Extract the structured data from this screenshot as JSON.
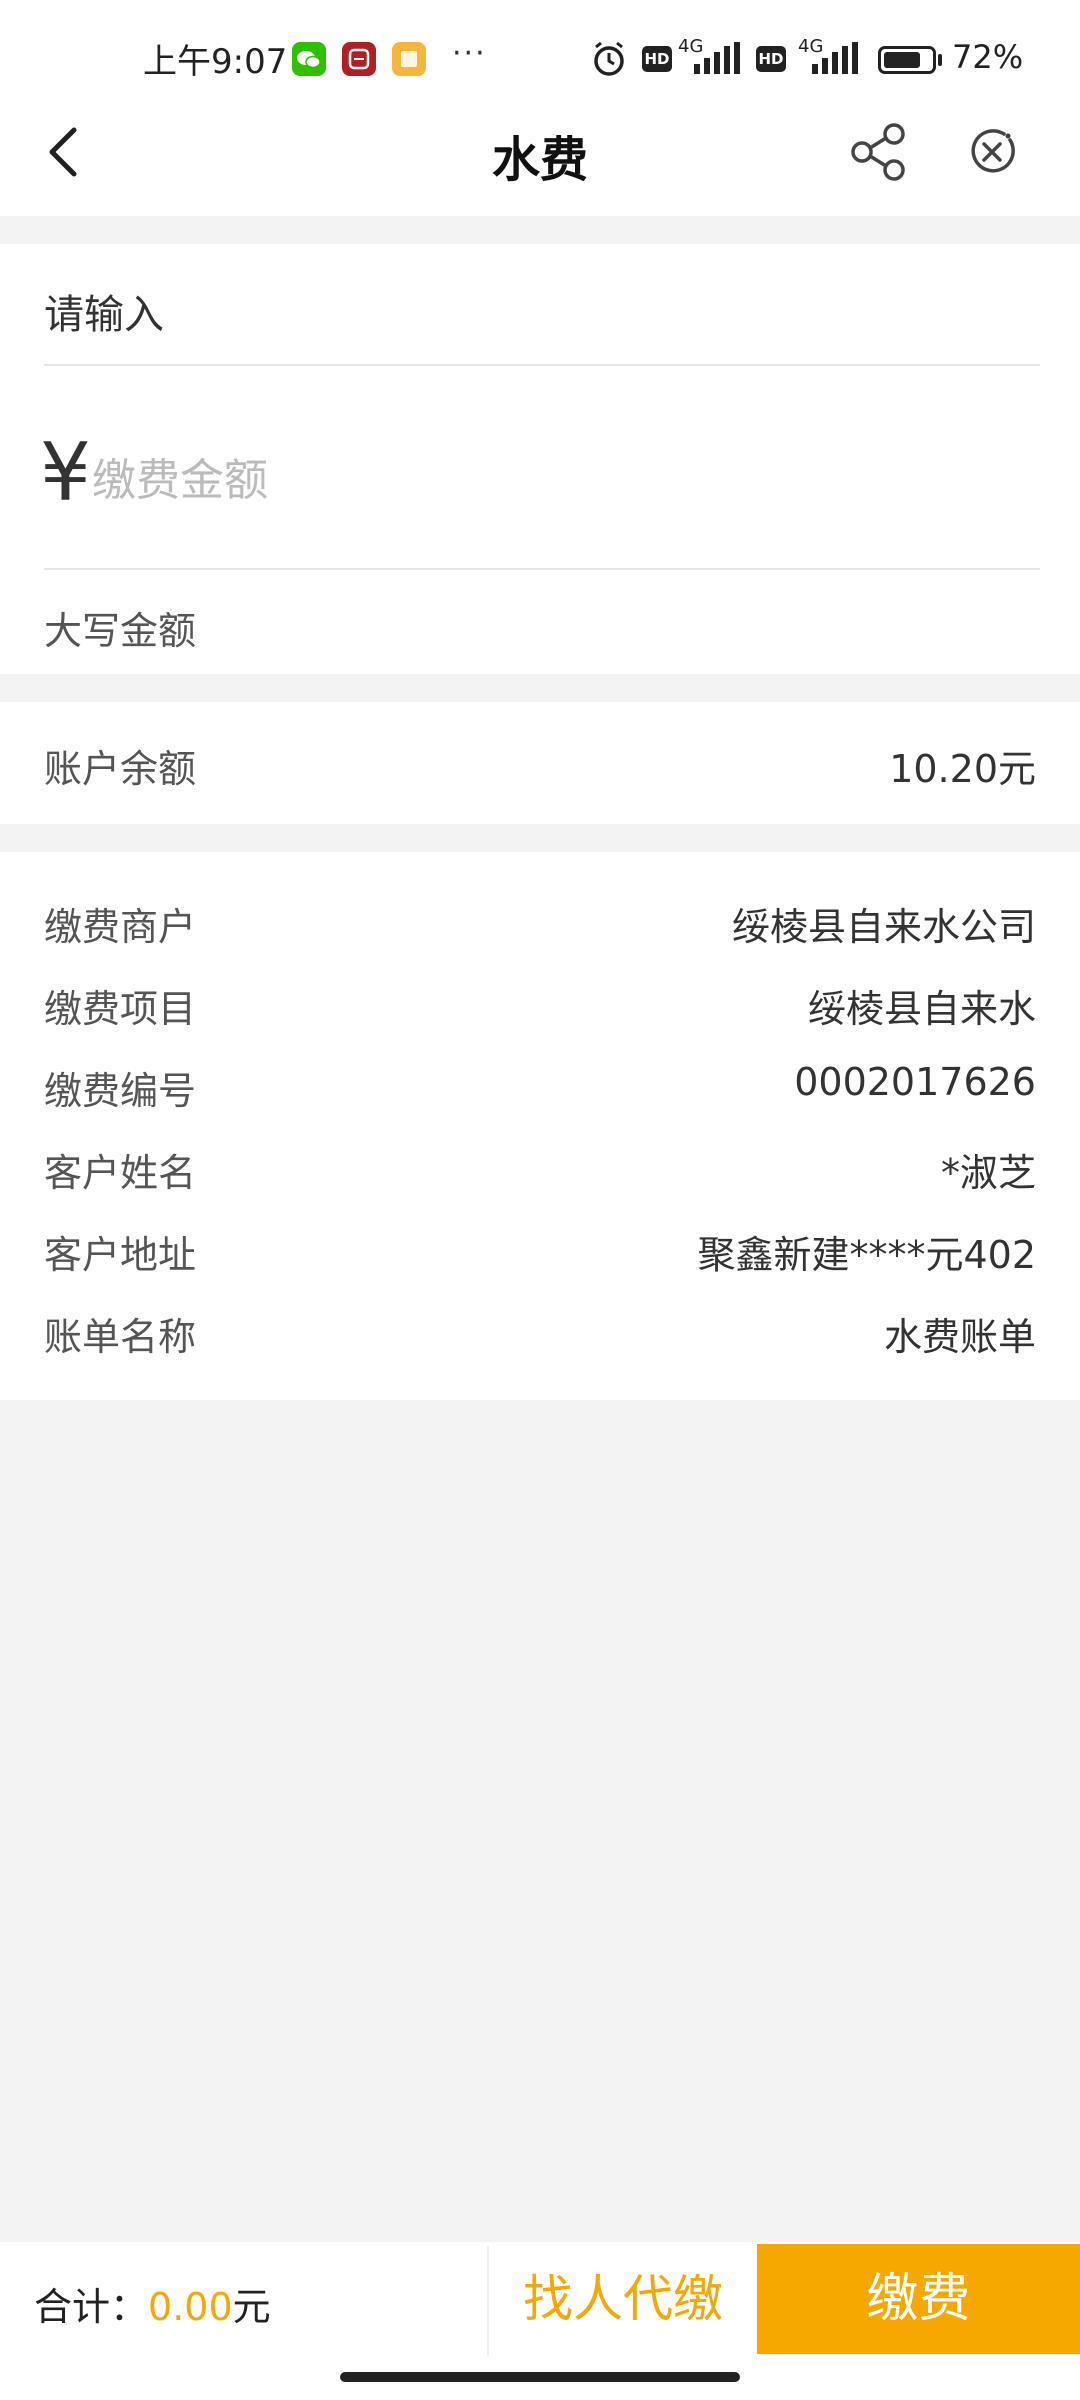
{
  "status_bar": {
    "time": "上午9:07",
    "dots": "···",
    "battery_percent": "72%",
    "network_1": "4G",
    "network_2": "4G",
    "hd_label": "HD"
  },
  "nav": {
    "title": "水费",
    "back_icon": "chevron-left-icon",
    "share_icon": "share-icon",
    "close_icon": "close-circle-icon"
  },
  "form": {
    "input_placeholder": "请输入",
    "currency_symbol": "¥",
    "amount_placeholder": "缴费金额",
    "capital_amount_label": "大写金额"
  },
  "balance": {
    "label": "账户余额",
    "value": "10.20元"
  },
  "details": [
    {
      "label": "缴费商户",
      "value": "绥棱县自来水公司"
    },
    {
      "label": "缴费项目",
      "value": "绥棱县自来水"
    },
    {
      "label": "缴费编号",
      "value": "0002017626"
    },
    {
      "label": "客户姓名",
      "value": "*淑芝"
    },
    {
      "label": "客户地址",
      "value": "聚鑫新建****元402"
    },
    {
      "label": "账单名称",
      "value": "水费账单"
    }
  ],
  "footer": {
    "total_label": "合计：",
    "total_amount": "0.00",
    "total_unit": "元",
    "proxy_pay_label": "找人代缴",
    "pay_label": "缴费"
  },
  "colors": {
    "accent": "#f7a800",
    "background": "#f3f3f3"
  }
}
